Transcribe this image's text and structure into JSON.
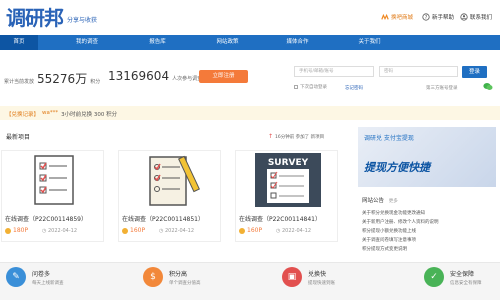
{
  "header": {
    "logo": "调研邦",
    "slogan": "分享与收获",
    "links": [
      {
        "label": "换吧商城",
        "icon": "mall-icon"
      },
      {
        "label": "新手帮助",
        "icon": "help-icon"
      },
      {
        "label": "联系我们",
        "icon": "contact-icon"
      }
    ]
  },
  "nav": {
    "items": [
      "首页",
      "我的调查",
      "报告库",
      "网站政策",
      "媒体合作",
      "关于我们"
    ]
  },
  "stats": {
    "cumulative_label": "累计当前发放",
    "points_value": "55276万",
    "points_unit": "积分",
    "participants_value": "13169604",
    "participants_label": "人次参与调查",
    "register_button": "立即注册"
  },
  "login": {
    "username_placeholder": "手机号/邮箱/账号",
    "password_placeholder": "密码",
    "login_button": "登录",
    "auto_login_label": "下次自动登录",
    "forgot_password": "忘记密码",
    "third_party_label": "第三方账号登录"
  },
  "notice": {
    "tag": "【兑换记录】",
    "user": "wa***",
    "text": "3小时前兑换 300 积分"
  },
  "latest": {
    "title": "最新项目",
    "hint": "16分钟前 参加了 新项目"
  },
  "cards": [
    {
      "title": "在线调查（P22C00114859）",
      "points": "180P",
      "date": "2022-04-12",
      "icon": "survey-checklist-icon"
    },
    {
      "title": "在线调查（P22C00114851）",
      "points": "160P",
      "date": "2022-04-12",
      "icon": "survey-pencil-icon"
    },
    {
      "title": "在线调查（P22C00114841）",
      "points": "160P",
      "date": "2022-04-12",
      "icon": "survey-board-icon"
    }
  ],
  "banner": {
    "line1": "调研兑  支付宝提现",
    "line2": "提现方便快捷"
  },
  "news": {
    "title": "网站公告",
    "more": "更多",
    "items": [
      "关于积分兑换现金功能更改通知",
      "关于新用户注册、修改个人资料的说明",
      "积分提现小额兑换功能上线",
      "关于调查问卷填写注意事项",
      "积分提现方式变更说明"
    ]
  },
  "footer": {
    "items": [
      {
        "title": "问卷多",
        "sub": "每天上线新调查",
        "color": "#3a8fd8",
        "icon": "survey-icon"
      },
      {
        "title": "积分高",
        "sub": "单个调查分值高",
        "color": "#f2883a",
        "icon": "coin-icon"
      },
      {
        "title": "兑换快",
        "sub": "提现快速到账",
        "color": "#e2504f",
        "icon": "gift-icon"
      },
      {
        "title": "安全保障",
        "sub": "信息安全有保障",
        "color": "#49b357",
        "icon": "shield-icon"
      }
    ]
  }
}
